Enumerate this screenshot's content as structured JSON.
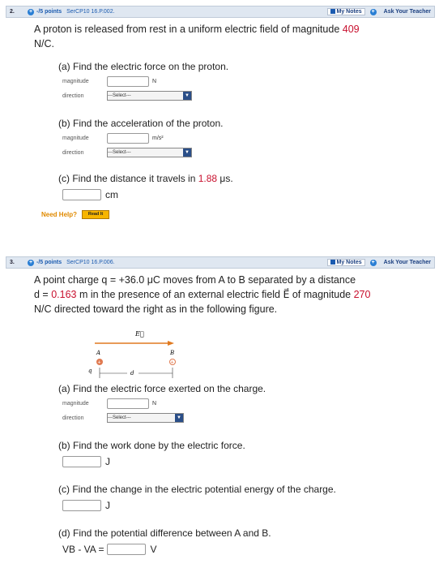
{
  "q2": {
    "num": "2.",
    "points": "-/5 points",
    "code": "SerCP10 16.P.002.",
    "my_notes": "My Notes",
    "ask_teacher": "Ask Your Teacher",
    "stem_pre": "A proton is released from rest in a uniform electric field of magnitude ",
    "stem_val": "409",
    "stem_post": "N/C.",
    "part_a": "(a) Find the electric force on the proton.",
    "magnitude_label": "magnitude",
    "direction_label": "direction",
    "unit_n": "N",
    "select_label": "---Select---",
    "part_b": "(b) Find the acceleration of the proton.",
    "unit_accel": "m/s²",
    "part_c_pre": "(c) Find the distance it travels in ",
    "part_c_val": "1.88",
    "part_c_post": " μs.",
    "unit_cm": "cm",
    "need_help": "Need Help?",
    "read_it": "Read It"
  },
  "q3": {
    "num": "3.",
    "points": "-/5 points",
    "code": "SerCP10 16.P.006.",
    "my_notes": "My Notes",
    "ask_teacher": "Ask Your Teacher",
    "stem_1a": "A point charge ",
    "stem_1q": "q = +36.0 μC",
    "stem_1b": " moves from A to B separated by a distance",
    "stem_2a": "d = ",
    "stem_2val": "0.163",
    "stem_2b": " m in the presence of an external electric field E⃗ of magnitude ",
    "stem_2val2": "270",
    "stem_3": "N/C directed toward the right as in the following figure.",
    "fig_E": "E⃗",
    "fig_A": "A",
    "fig_B": "B",
    "fig_q": "q",
    "fig_d": "d",
    "part_a": "(a) Find the electric force exerted on the charge.",
    "magnitude_label": "magnitude",
    "direction_label": "direction",
    "unit_n": "N",
    "select_label": "---Select---",
    "part_b": "(b) Find the work done by the electric force.",
    "unit_j": "J",
    "part_c": "(c) Find the change in the electric potential energy of the charge.",
    "part_d": "(d) Find the potential difference between A and B.",
    "vb_va": "VB - VA =",
    "unit_v": "V"
  }
}
